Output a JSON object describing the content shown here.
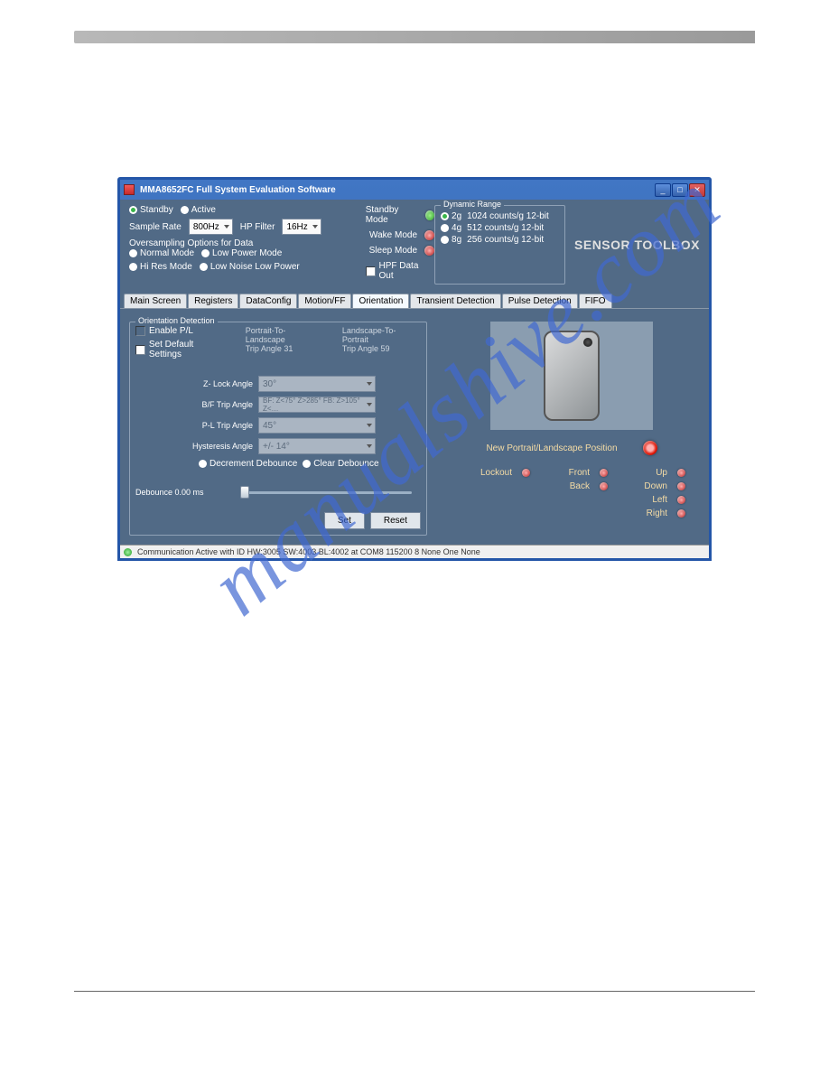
{
  "window": {
    "title": "MMA8652FC Full System Evaluation Software"
  },
  "top": {
    "mode_a": "Standby",
    "mode_b": "Active",
    "sample_rate_label": "Sample Rate",
    "sample_rate_value": "800Hz",
    "hp_filter_label": "HP Filter",
    "hp_filter_value": "16Hz",
    "oversampling_label": "Oversampling Options for Data",
    "opt_normal": "Normal Mode",
    "opt_lowpower": "Low Power Mode",
    "opt_hires": "Hi Res Mode",
    "opt_lownoise": "Low Noise Low Power",
    "hpf_data_out": "HPF Data Out",
    "standby_mode": "Standby Mode",
    "wake_mode": "Wake Mode",
    "sleep_mode": "Sleep Mode",
    "dynamic_range_legend": "Dynamic Range",
    "range_2g": "2g",
    "range_2g_desc": "1024 counts/g 12-bit",
    "range_4g": "4g",
    "range_4g_desc": "512 counts/g 12-bit",
    "range_8g": "8g",
    "range_8g_desc": "256 counts/g 12-bit",
    "brand": "SENSOR TOOLBOX"
  },
  "tabs": {
    "0": "Main Screen",
    "1": "Registers",
    "2": "DataConfig",
    "3": "Motion/FF",
    "4": "Orientation",
    "5": "Transient Detection",
    "6": "Pulse Detection",
    "7": "FIFO"
  },
  "orient": {
    "legend": "Orientation Detection",
    "enable_pl": "Enable P/L",
    "set_default": "Set Default Settings",
    "ptl_label": "Portrait-To-Landscape",
    "ptl_val": "Trip Angle  31",
    "ltp_label": "Landscape-To-Portrait",
    "ltp_val": "Trip Angle  59",
    "z_lock_label": "Z- Lock Angle",
    "z_lock_val": "30°",
    "bf_label": "B/F Trip Angle",
    "bf_val": "BF: Z<75° Z>285° FB: Z>105° Z<…",
    "pl_label": "P-L Trip Angle",
    "pl_val": "45°",
    "hyst_label": "Hysteresis Angle",
    "hyst_val": "+/- 14°",
    "dec_debounce": "Decrement Debounce",
    "clr_debounce": "Clear Debounce",
    "debounce_label": "Debounce 0.00    ms",
    "set_btn": "Set",
    "reset_btn": "Reset"
  },
  "right": {
    "new_pos": "New Portrait/Landscape Position",
    "lockout": "Lockout",
    "front": "Front",
    "back": "Back",
    "up": "Up",
    "down": "Down",
    "left": "Left",
    "right": "Right"
  },
  "statusbar": "Communication Active with ID HW:3005 SW:4003 BL:4002 at COM8 115200 8 None One None",
  "watermark": "manualshive.com"
}
